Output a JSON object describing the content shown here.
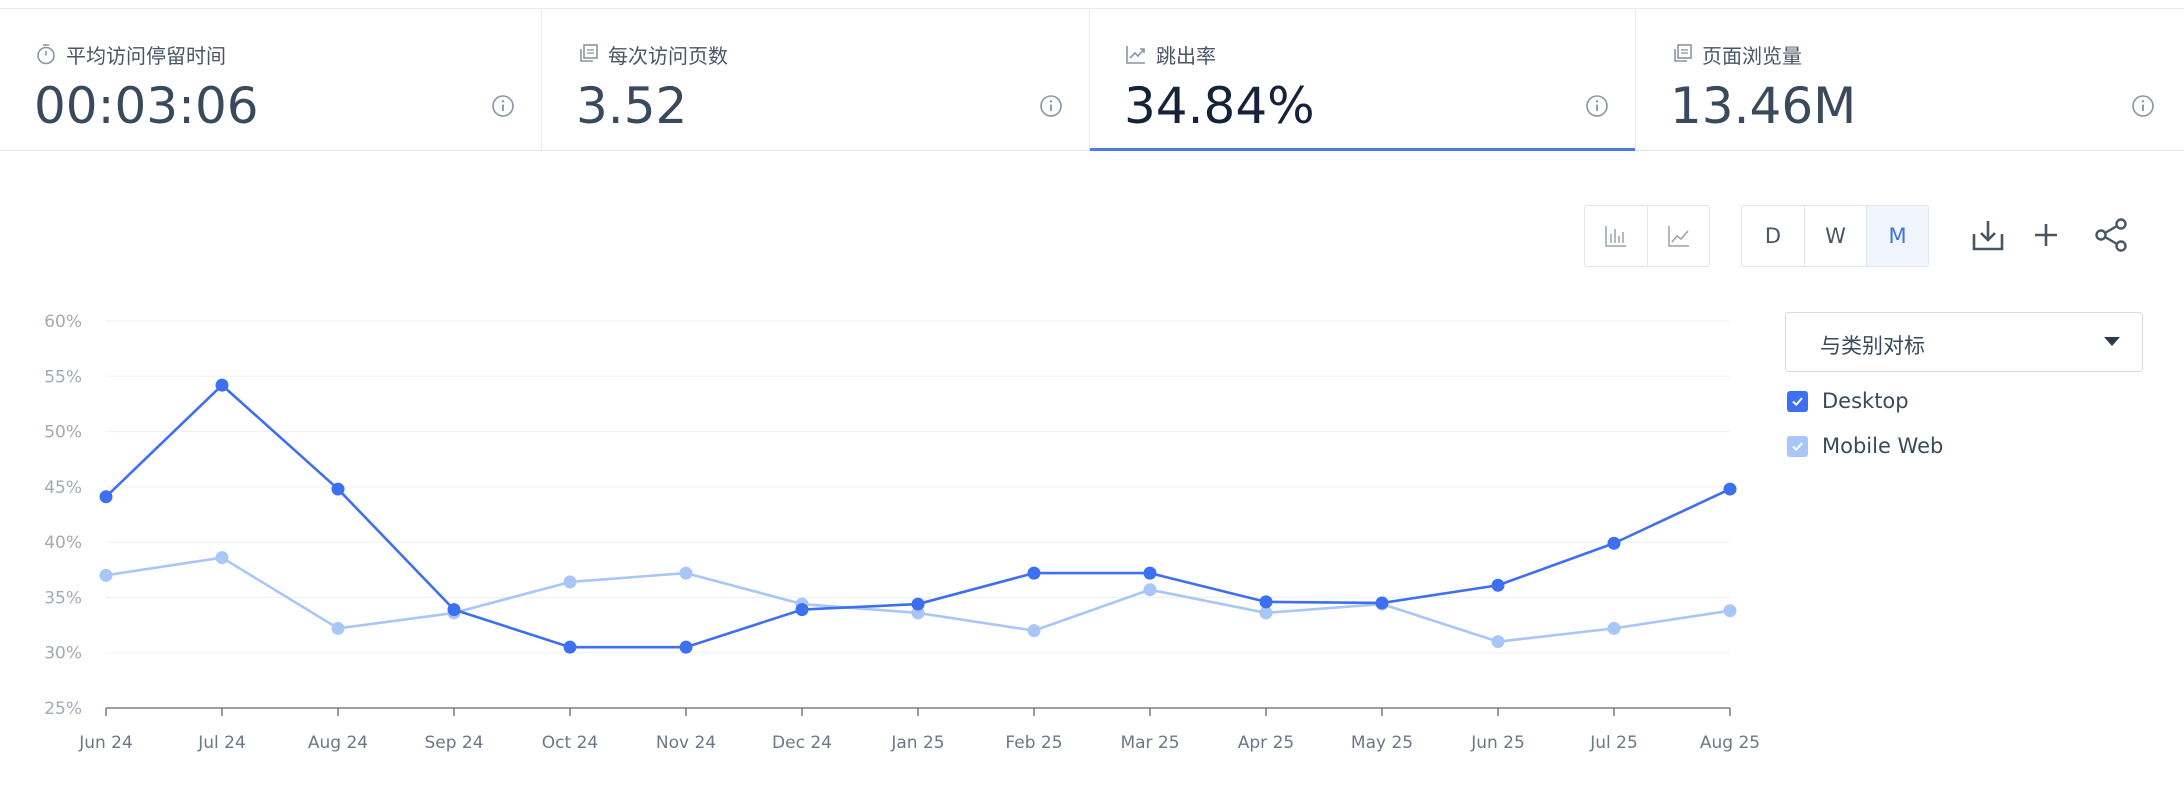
{
  "metrics": [
    {
      "label": "平均访问停留时间",
      "value": "00:03:06",
      "icon": "stopwatch-icon",
      "active": false
    },
    {
      "label": "每次访问页数",
      "value": "3.52",
      "icon": "pages-icon",
      "active": false
    },
    {
      "label": "跳出率",
      "value": "34.84%",
      "icon": "trend-up-icon",
      "active": true
    },
    {
      "label": "页面浏览量",
      "value": "13.46M",
      "icon": "pages-icon",
      "active": false
    }
  ],
  "toolbar": {
    "chart_types": [
      {
        "icon": "bar-chart-icon"
      },
      {
        "icon": "line-chart-icon"
      }
    ],
    "granularity": {
      "options": [
        "D",
        "W",
        "M"
      ],
      "selected": "M"
    },
    "actions": [
      {
        "icon": "download-icon"
      },
      {
        "icon": "plus-icon"
      },
      {
        "icon": "share-icon"
      }
    ]
  },
  "benchmark_dropdown": {
    "selected": "与类别对标"
  },
  "legend": [
    {
      "name": "Desktop",
      "checked": true,
      "color": "#3d6ff0"
    },
    {
      "name": "Mobile Web",
      "checked": true,
      "color": "#a8c6f7"
    }
  ],
  "chart_data": {
    "type": "line",
    "categories": [
      "Jun 24",
      "Jul 24",
      "Aug 24",
      "Sep 24",
      "Oct 24",
      "Nov 24",
      "Dec 24",
      "Jan 25",
      "Feb 25",
      "Mar 25",
      "Apr 25",
      "May 25",
      "Jun 25",
      "Jul 25",
      "Aug 25"
    ],
    "series": [
      {
        "name": "Desktop",
        "color": "#3d6ff0",
        "values": [
          44.1,
          54.2,
          44.8,
          33.9,
          30.5,
          30.5,
          33.9,
          34.4,
          37.2,
          37.2,
          34.6,
          34.5,
          36.1,
          39.9,
          44.8
        ]
      },
      {
        "name": "Mobile Web",
        "color": "#a8c6f7",
        "values": [
          37.0,
          38.6,
          32.2,
          33.6,
          36.4,
          37.2,
          34.4,
          33.6,
          32.0,
          35.7,
          33.6,
          34.4,
          31.0,
          32.2,
          33.8
        ]
      }
    ],
    "y_ticks": [
      "25%",
      "30%",
      "35%",
      "40%",
      "45%",
      "50%",
      "55%",
      "60%"
    ],
    "ylim": [
      25,
      60
    ],
    "grid": true
  }
}
